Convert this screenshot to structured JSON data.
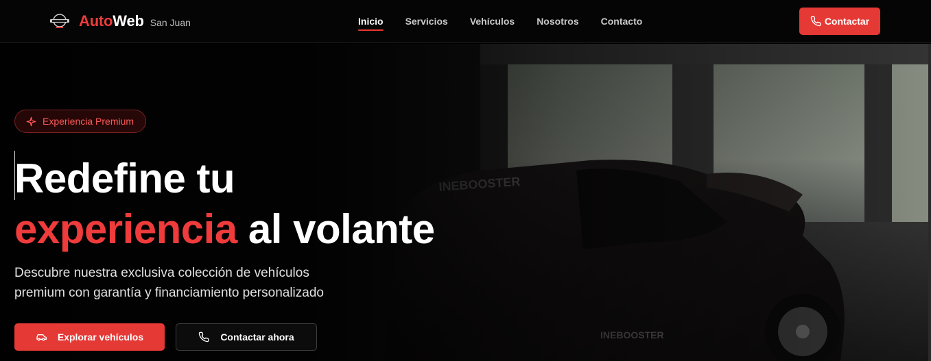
{
  "brand": {
    "auto": "Auto",
    "web": "Web",
    "city": "San Juan",
    "logo_icon": "car-logo-icon"
  },
  "nav": {
    "items": [
      {
        "label": "Inicio",
        "active": true
      },
      {
        "label": "Servicios",
        "active": false
      },
      {
        "label": "Vehículos",
        "active": false
      },
      {
        "label": "Nosotros",
        "active": false
      },
      {
        "label": "Contacto",
        "active": false
      }
    ]
  },
  "header_cta": {
    "label": "Contactar",
    "icon": "phone-icon"
  },
  "hero": {
    "badge": {
      "label": "Experiencia Premium",
      "icon": "sparkle-icon"
    },
    "headline": {
      "line1": "Redefine tu",
      "accent": "experiencia",
      "rest": " al volante"
    },
    "subtitle_line1": "Descubre nuestra exclusiva colección de vehículos",
    "subtitle_line2": "premium con garantía y financiamiento personalizado",
    "primary_button": {
      "label": "Explorar vehículos",
      "icon": "car-icon"
    },
    "secondary_button": {
      "label": "Contactar ahora",
      "icon": "phone-icon"
    }
  },
  "colors": {
    "accent": "#e53935",
    "accent_text": "#ef3b3b",
    "background": "#050505"
  }
}
